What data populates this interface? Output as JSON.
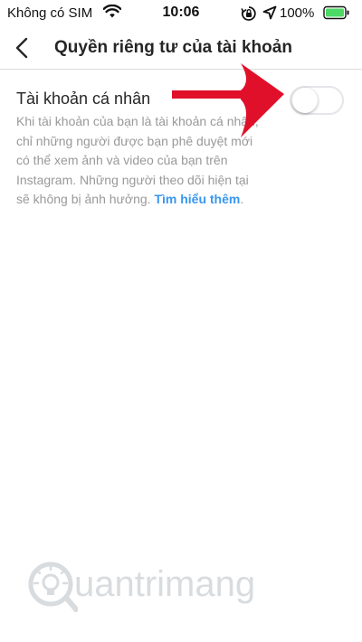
{
  "status_bar": {
    "carrier": "Không có SIM",
    "time": "10:06",
    "battery": "100%"
  },
  "nav": {
    "title": "Quyền riêng tư của tài khoản",
    "back_icon": "chevron-left-icon"
  },
  "private_account": {
    "label": "Tài khoản cá nhân",
    "toggle_on": false,
    "description": "Khi tài khoản của bạn là tài khoản cá nhân, chỉ những người được bạn phê duyệt mới có thể xem ảnh và video của bạn trên Instagram. Những người theo dõi hiện tại sẽ không bị ảnh hưởng.",
    "learn_more": "Tìm hiểu thêm",
    "period": "."
  },
  "watermark": {
    "text": "uantrimang"
  },
  "colors": {
    "link": "#3897f0",
    "arrow": "#e0102a",
    "secondary_text": "#999999"
  }
}
